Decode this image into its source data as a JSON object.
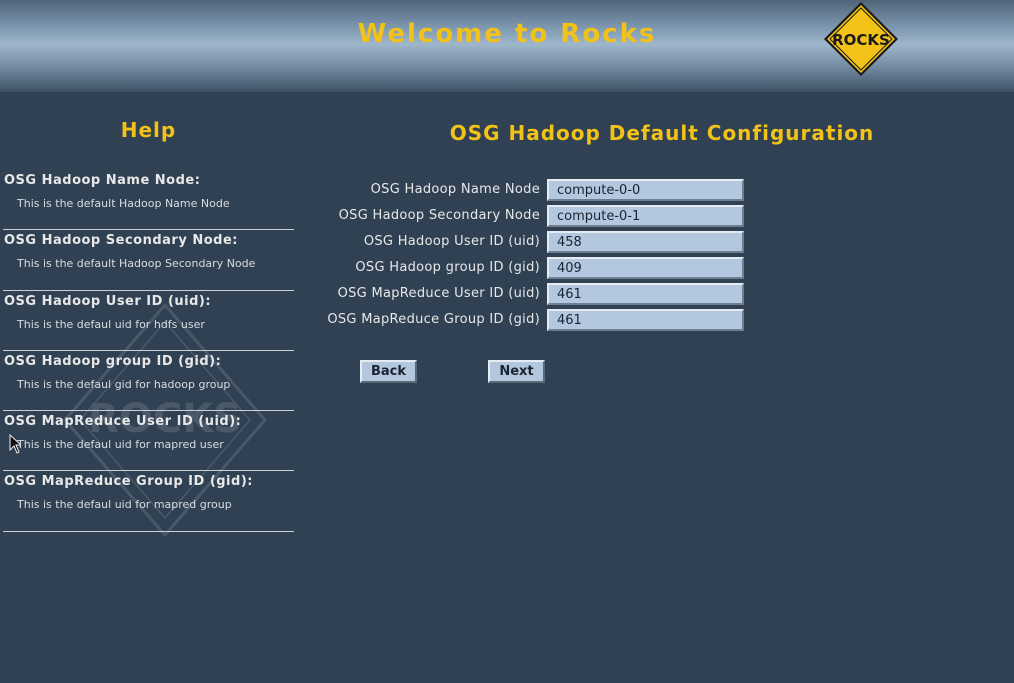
{
  "header": {
    "title": "Welcome to Rocks",
    "logo_text": "ROCKS"
  },
  "watermark": {
    "text": "ROCKS"
  },
  "help": {
    "heading": "Help",
    "items": [
      {
        "title": "OSG Hadoop Name Node:",
        "description": "This is the default Hadoop Name Node"
      },
      {
        "title": "OSG Hadoop Secondary Node:",
        "description": "This is the default Hadoop Secondary Node"
      },
      {
        "title": "OSG Hadoop User ID (uid):",
        "description": "This is the defaul uid for hdfs user"
      },
      {
        "title": "OSG Hadoop group ID (gid):",
        "description": "This is the defaul gid for hadoop group"
      },
      {
        "title": "OSG MapReduce User ID (uid):",
        "description": "This is the defaul uid for mapred user"
      },
      {
        "title": "OSG MapReduce Group ID (gid):",
        "description": "This is the defaul uid for mapred group"
      }
    ]
  },
  "form": {
    "title": "OSG Hadoop Default Configuration",
    "fields": [
      {
        "label": "OSG Hadoop Name Node",
        "value": "compute-0-0"
      },
      {
        "label": "OSG Hadoop Secondary Node",
        "value": "compute-0-1"
      },
      {
        "label": "OSG Hadoop User ID (uid)",
        "value": "458"
      },
      {
        "label": "OSG Hadoop group ID (gid)",
        "value": "409"
      },
      {
        "label": "OSG MapReduce User ID (uid)",
        "value": "461"
      },
      {
        "label": "OSG MapReduce Group ID (gid)",
        "value": "461"
      }
    ],
    "back_label": "Back",
    "next_label": "Next"
  },
  "colors": {
    "background": "#2f4152",
    "accent": "#f2c218",
    "input_background": "#b3c7df"
  }
}
